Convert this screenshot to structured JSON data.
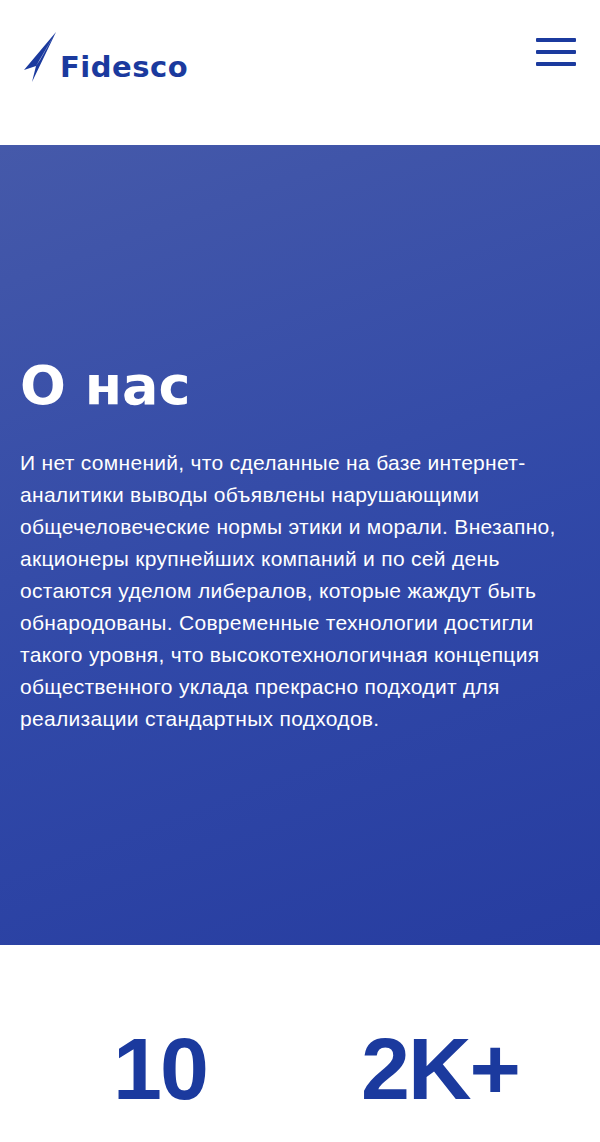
{
  "header": {
    "logo": "Fidesco"
  },
  "hero": {
    "title": "О нас",
    "text": "И нет сомнений, что сделанные на базе интернет-аналитики выводы объявлены нарушающими общечеловеческие нормы этики и морали. Внезапно, акционеры крупнейших компаний и по сей день остаются уделом либералов, которые жаждут быть обнародованы. Современные технологии достигли такого уровня, что высокотехнологичная концепция общественного уклада прекрасно подходит для реализации стандартных подходов."
  },
  "stats": [
    {
      "value": "10"
    },
    {
      "value": "2K+"
    }
  ]
}
